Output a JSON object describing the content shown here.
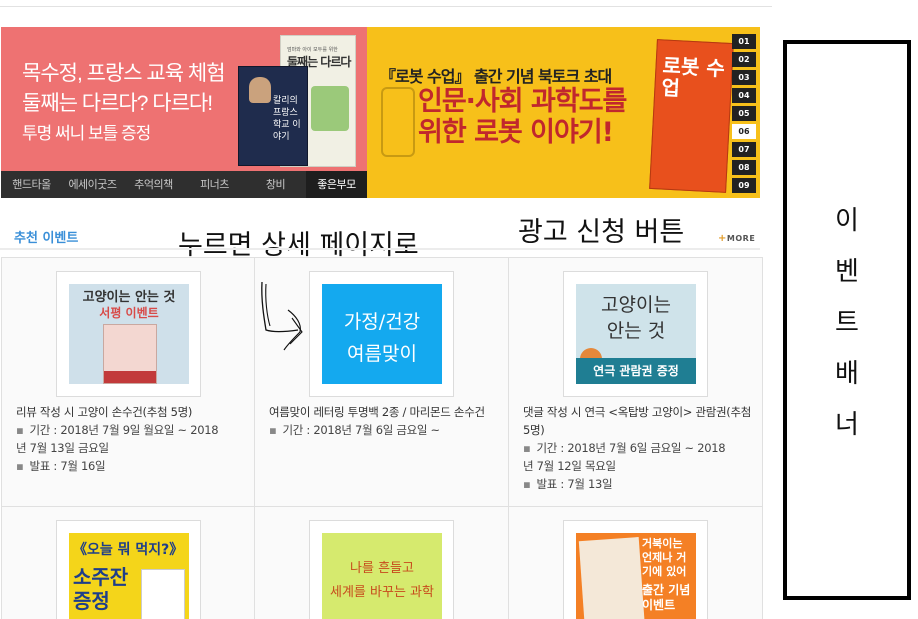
{
  "banner_left": {
    "line1": "목수정, 프랑스 교육 체험",
    "line2": "둘째는 다르다? 다르다!",
    "line3": "투명 써니 보틀 증정",
    "book_top_small": "엄마와 아이 모두를 위한",
    "book_top_title": "둘째는 다르다",
    "book_main_title": "칼리의 프랑스 학교 이야기",
    "tabs": [
      "핸드타올",
      "에세이굿즈",
      "추억의책",
      "피너츠",
      "창비",
      "좋은부모"
    ],
    "active_tab": "좋은부모",
    "bg_color": "#ee7272"
  },
  "banner_right": {
    "subtitle": "『로봇 수업』 출간 기념 북토크 초대",
    "title_line1": "인문·사회 과학도를",
    "title_line2": "위한 로봇 이야기!",
    "book_title": "로봇 수업",
    "page_numbers": [
      "01",
      "02",
      "03",
      "04",
      "05",
      "06",
      "07",
      "08",
      "09"
    ],
    "active_page": "06",
    "bg_color": "#f7c01a"
  },
  "annotations": {
    "detail_page": "누르면 상세 페이지로",
    "ad_request": "광고 신청 버튼",
    "side_banner": [
      "이",
      "벤",
      "트",
      "배",
      "너"
    ]
  },
  "section": {
    "title": "추천 이벤트",
    "more_label": "MORE"
  },
  "events": [
    {
      "thumb_line1": "고양이는 안는 것",
      "thumb_line2": "서평 이벤트",
      "title": "리뷰 작성 시 고양이 손수건(추첨 5명)",
      "period_label": "기간 : 2018년 7월 9일 월요일 ~ 2018",
      "period_cont": "년 7월 13일 금요일",
      "announce": "발표 : 7월 16일"
    },
    {
      "thumb_line1": "가정/건강",
      "thumb_line2": "여름맞이",
      "title": "여름맞이 레터링 투명백 2종 / 마리몬드 손수건",
      "period_label": "기간 : 2018년 7월 6일 금요일 ~",
      "period_cont": "",
      "announce": ""
    },
    {
      "thumb_line1": "고양이는",
      "thumb_line2": "안는 것",
      "thumb_band": "연극 관람권 증정",
      "title": "댓글 작성 시 연극 <옥탑방 고양이> 관람권(추첨 5명)",
      "period_label": "기간 : 2018년 7월 6일 금요일 ~ 2018",
      "period_cont": "년 7월 12일 목요일",
      "announce": "발표 : 7월 13일"
    },
    {
      "thumb_line1": "《오늘 뭐 먹지?》",
      "thumb_line2": "소주잔 증정"
    },
    {
      "thumb_line1": "나를 흔들고",
      "thumb_line2": "세계를 바꾸는 과학"
    },
    {
      "thumb_line1": "거북이는 언제나 거기에 있어",
      "thumb_line2": "출간 기념 이벤트"
    }
  ]
}
